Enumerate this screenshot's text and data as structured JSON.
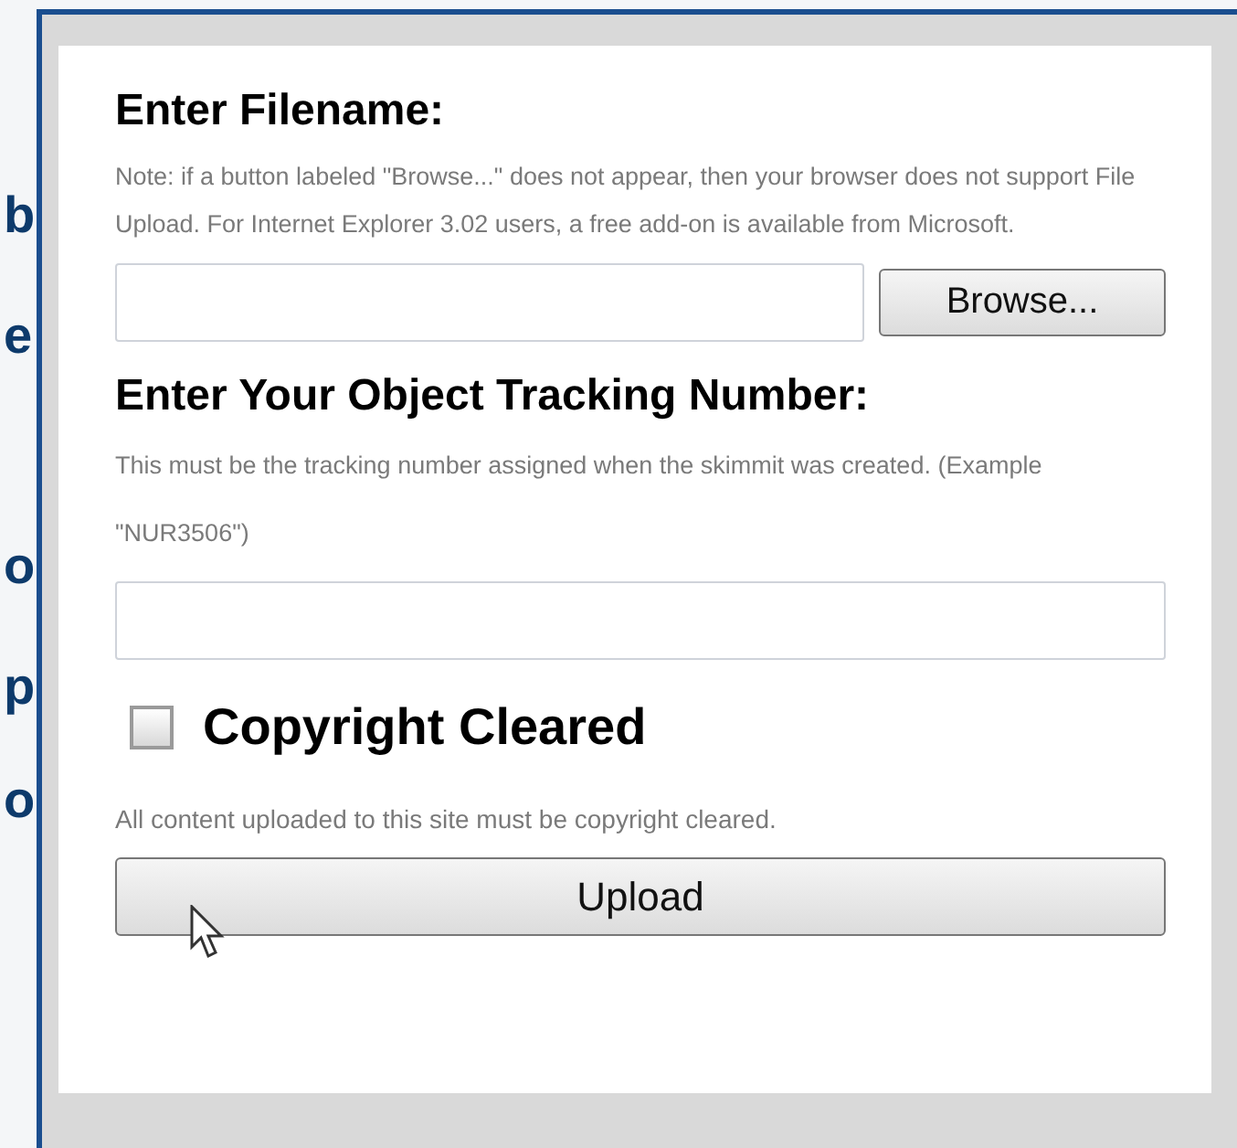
{
  "background_text": [
    "b",
    "e",
    "o",
    "p",
    "o"
  ],
  "file_section": {
    "heading": "Enter Filename:",
    "note": "Note: if a button labeled \"Browse...\" does not appear, then your browser does not support File Upload. For Internet Explorer 3.02 users, a free add-on is available from Microsoft.",
    "browse_button": "Browse..."
  },
  "tracking_section": {
    "heading": "Enter Your Object Tracking Number:",
    "note": "This must be the tracking number assigned when the skimmit was created. (Example \"NUR3506\")"
  },
  "copyright": {
    "label": "Copyright Cleared",
    "checked": false,
    "note": "All content uploaded to this site must be copyright cleared."
  },
  "upload_button": "Upload"
}
